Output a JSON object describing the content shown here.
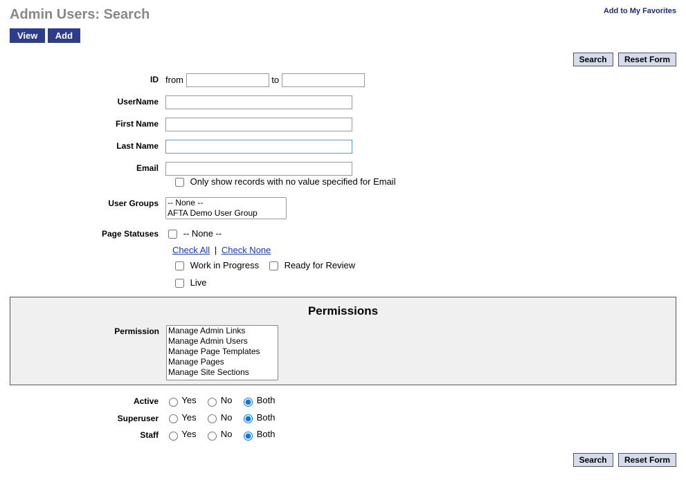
{
  "header": {
    "title": "Admin Users: Search",
    "favorites_link": "Add to My Favorites"
  },
  "tabs": {
    "view": "View",
    "add": "Add"
  },
  "buttons": {
    "search": "Search",
    "reset": "Reset Form"
  },
  "labels": {
    "id": "ID",
    "from": "from",
    "to": "to",
    "username": "UserName",
    "first_name": "First Name",
    "last_name": "Last Name",
    "email": "Email",
    "email_empty_note": "Only show records with no value specified for Email",
    "user_groups": "User Groups",
    "page_statuses": "Page Statuses",
    "permission": "Permission",
    "active": "Active",
    "superuser": "Superuser",
    "staff": "Staff"
  },
  "user_groups_options": {
    "none": "-- None --",
    "afta": "AFTA Demo User Group"
  },
  "page_statuses": {
    "none": "-- None --",
    "check_all": "Check All",
    "check_none": "Check None",
    "wip": "Work in Progress",
    "ready": "Ready for Review",
    "live": "Live"
  },
  "permissions_panel": {
    "title": "Permissions",
    "options": {
      "o1": "Manage Admin Links",
      "o2": "Manage Admin Users",
      "o3": "Manage Page Templates",
      "o4": "Manage Pages",
      "o5": "Manage Site Sections"
    }
  },
  "radio": {
    "yes": "Yes",
    "no": "No",
    "both": "Both"
  }
}
